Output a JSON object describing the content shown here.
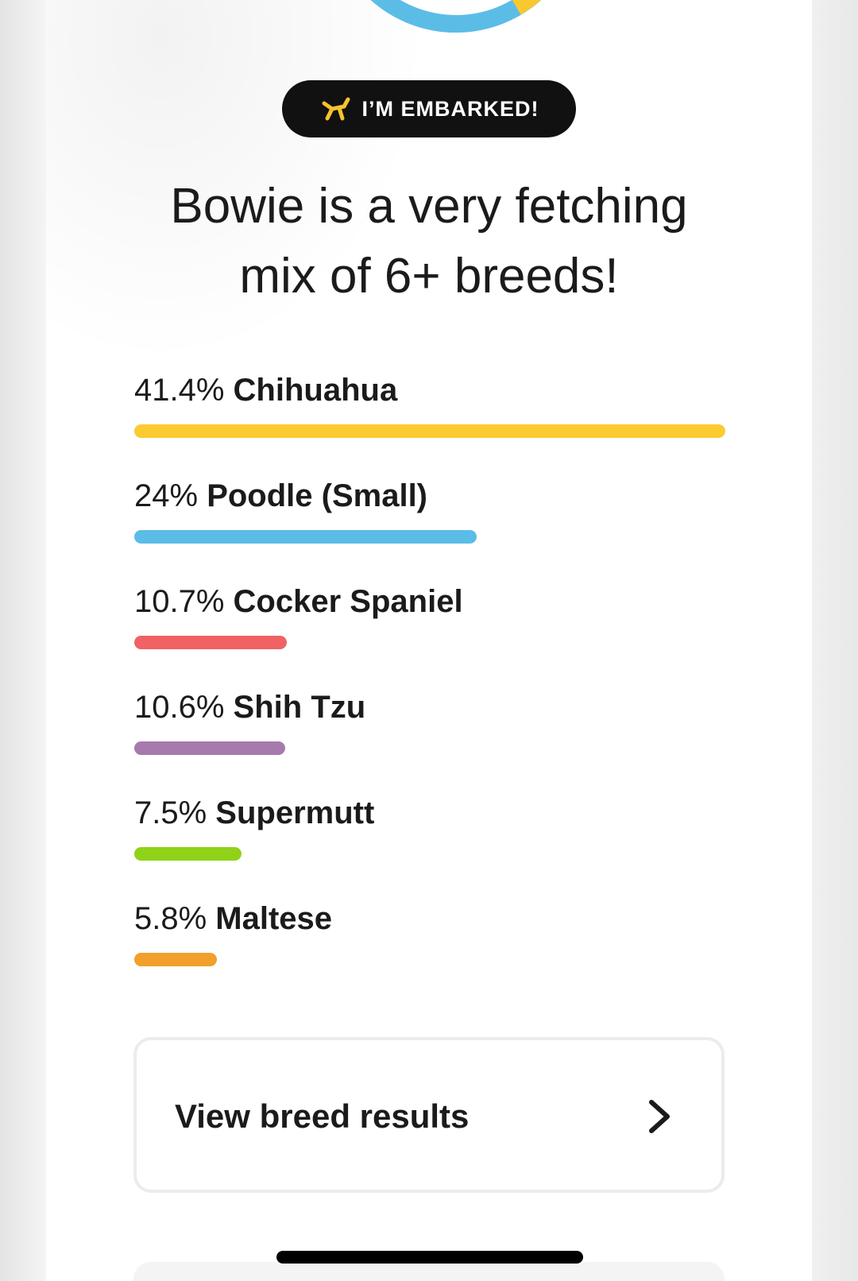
{
  "badge": {
    "text": "I’M EMBARKED!",
    "icon": "balloon-dog-icon",
    "icon_color": "#f6c22e",
    "background": "#111111"
  },
  "headline": {
    "line1": "Bowie is a very fetching",
    "line2": "mix of 6+ breeds!"
  },
  "donut": {
    "colors": [
      "#f9c730",
      "#5bbde6"
    ]
  },
  "breeds": [
    {
      "percent_label": "41.4%",
      "name": "Chihuahua",
      "percent": 41.4,
      "color": "#fccb32"
    },
    {
      "percent_label": "24%",
      "name": "Poodle (Small)",
      "percent": 24,
      "color": "#5bbde6"
    },
    {
      "percent_label": "10.7%",
      "name": "Cocker Spaniel",
      "percent": 10.7,
      "color": "#f06263"
    },
    {
      "percent_label": "10.6%",
      "name": "Shih Tzu",
      "percent": 10.6,
      "color": "#a67aad"
    },
    {
      "percent_label": "7.5%",
      "name": "Supermutt",
      "percent": 7.5,
      "color": "#8fd218"
    },
    {
      "percent_label": "5.8%",
      "name": "Maltese",
      "percent": 5.8,
      "color": "#f0a02b"
    }
  ],
  "results_button": {
    "label": "View breed results",
    "icon": "chevron-right-icon"
  }
}
